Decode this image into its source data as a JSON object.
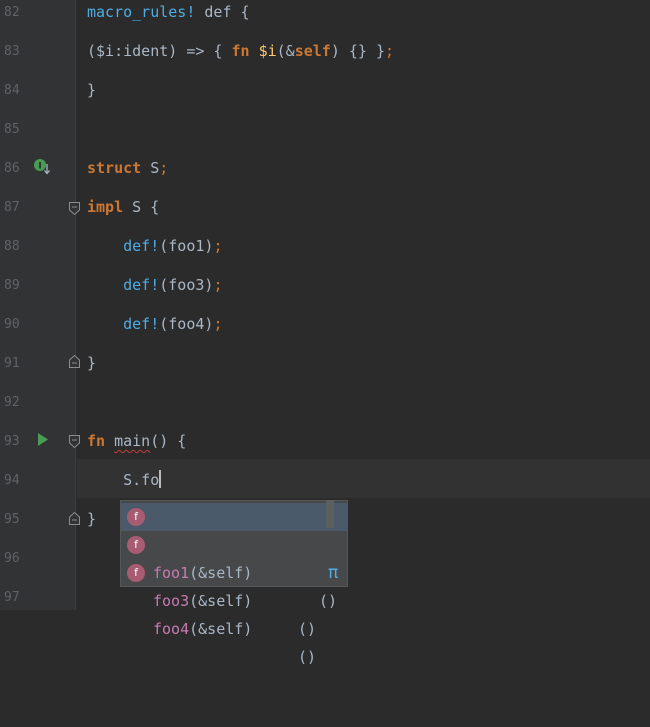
{
  "editor": {
    "lines": [
      {
        "num": "82",
        "segments": [
          {
            "t": "macro_rules!",
            "c": "macro"
          },
          {
            "t": " def {",
            "c": ""
          }
        ]
      },
      {
        "num": "83",
        "segments": [
          {
            "t": "($i:ident) => { ",
            "c": ""
          },
          {
            "t": "fn",
            "c": "kw"
          },
          {
            "t": " ",
            "c": ""
          },
          {
            "t": "$i",
            "c": "fn-name"
          },
          {
            "t": "(&",
            "c": ""
          },
          {
            "t": "self",
            "c": "kw"
          },
          {
            "t": ") {} }",
            "c": ""
          },
          {
            "t": ";",
            "c": "punc"
          }
        ]
      },
      {
        "num": "84",
        "segments": [
          {
            "t": "}",
            "c": ""
          }
        ]
      },
      {
        "num": "85",
        "segments": []
      },
      {
        "num": "86",
        "segments": [
          {
            "t": "struct",
            "c": "kw"
          },
          {
            "t": " S",
            "c": ""
          },
          {
            "t": ";",
            "c": "punc"
          }
        ]
      },
      {
        "num": "87",
        "segments": [
          {
            "t": "impl",
            "c": "kw"
          },
          {
            "t": " S {",
            "c": ""
          }
        ]
      },
      {
        "num": "88",
        "segments": [
          {
            "t": "    ",
            "c": ""
          },
          {
            "t": "def!",
            "c": "macro"
          },
          {
            "t": "(foo1)",
            "c": ""
          },
          {
            "t": ";",
            "c": "punc"
          }
        ]
      },
      {
        "num": "89",
        "segments": [
          {
            "t": "    ",
            "c": ""
          },
          {
            "t": "def!",
            "c": "macro"
          },
          {
            "t": "(foo3)",
            "c": ""
          },
          {
            "t": ";",
            "c": "punc"
          }
        ]
      },
      {
        "num": "90",
        "segments": [
          {
            "t": "    ",
            "c": ""
          },
          {
            "t": "def!",
            "c": "macro"
          },
          {
            "t": "(foo4)",
            "c": ""
          },
          {
            "t": ";",
            "c": "punc"
          }
        ]
      },
      {
        "num": "91",
        "segments": [
          {
            "t": "}",
            "c": ""
          }
        ]
      },
      {
        "num": "92",
        "segments": []
      },
      {
        "num": "93",
        "segments": [
          {
            "t": "fn",
            "c": "kw"
          },
          {
            "t": " ",
            "c": ""
          },
          {
            "t": "main",
            "c": "squiggle"
          },
          {
            "t": "() {",
            "c": ""
          }
        ]
      },
      {
        "num": "94",
        "segments": [
          {
            "t": "    S.fo",
            "c": ""
          }
        ]
      },
      {
        "num": "95",
        "segments": [
          {
            "t": "}",
            "c": ""
          }
        ]
      },
      {
        "num": "96",
        "segments": []
      },
      {
        "num": "97",
        "segments": []
      }
    ]
  },
  "completion": {
    "items": [
      {
        "badge": "f",
        "name": "foo1",
        "sig": "(&self)",
        "type": "()",
        "selected": true
      },
      {
        "badge": "f",
        "name": "foo3",
        "sig": "(&self)",
        "type": "()",
        "selected": false
      },
      {
        "badge": "f",
        "name": "foo4",
        "sig": "(&self)",
        "type": "()",
        "selected": false
      }
    ],
    "pi_symbol": "π"
  },
  "colors": {
    "background": "#2b2b2b",
    "keyword": "#cc7832",
    "macro": "#4eade5",
    "text": "#a9b7c6",
    "completion_name": "#c77bb1",
    "run_icon": "#499c54"
  },
  "icons": {
    "line86": "implemented-trait-icon",
    "line93": "run-icon"
  }
}
